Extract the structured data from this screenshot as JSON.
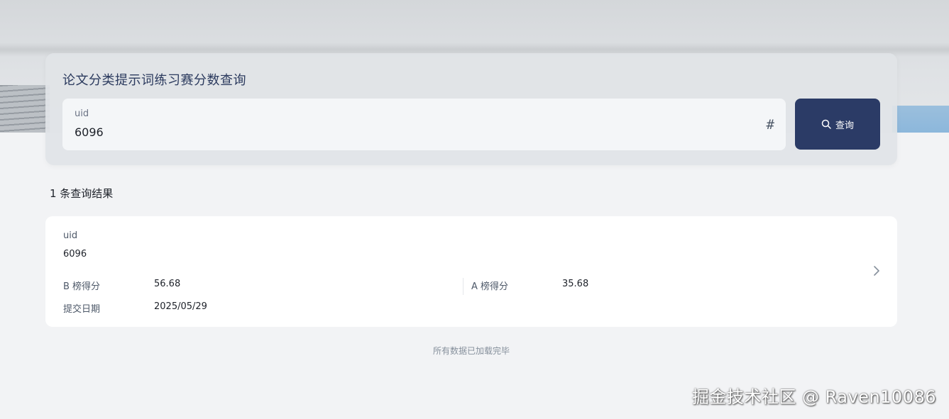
{
  "query": {
    "title": "论文分类提示词练习赛分数查询",
    "input_label": "uid",
    "input_value": "6096",
    "search_label": "查询"
  },
  "results": {
    "count_text": "1 条查询结果",
    "items": [
      {
        "uid_label": "uid",
        "uid_value": "6096",
        "b_score_label": "B 榜得分",
        "b_score_value": "56.68",
        "a_score_label": "A 榜得分",
        "a_score_value": "35.68",
        "date_label": "提交日期",
        "date_value": "2025/05/29"
      }
    ]
  },
  "footer": {
    "note": "所有数据已加载完毕"
  },
  "watermark": "掘金技术社区 @ Raven10086",
  "colors": {
    "accent": "#2b3b66",
    "page_bg": "#f2f3f5",
    "card_bg": "#ffffff"
  }
}
